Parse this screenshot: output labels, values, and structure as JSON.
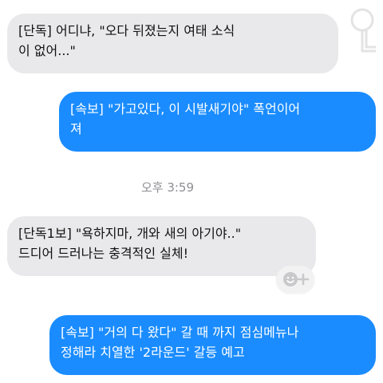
{
  "messages": [
    {
      "sender": "other",
      "text": "[단독] 어디냐, \"오다 뒤졌는지 여태 소식\n이 없어...\""
    },
    {
      "sender": "me",
      "text": "[속보] \"가고있다, 이 시발새기야\" 폭언이어\n져"
    },
    {
      "sender": "other",
      "text": "[단독1보] \"욕하지마, 개와 새의 아기야..\"\n드디어 드러나는 충격적인 실체!"
    },
    {
      "sender": "me",
      "text": "[속보] \"거의 다 왔다\" 갈 때 까지 점심메뉴나\n정해라 치열한 '2라운드' 갈등 예고"
    }
  ],
  "timestamp": "오후 3:59",
  "icons": {
    "reaction": "smiley-add-icon",
    "watermark": "watermark-logo"
  },
  "colors": {
    "incoming_bubble": "#e9e9eb",
    "outgoing_bubble": "#1a8cff",
    "timestamp_text": "#8e8e93"
  }
}
